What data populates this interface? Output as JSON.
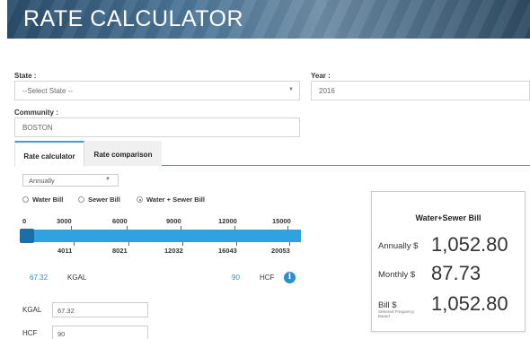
{
  "header": {
    "title": "RATE CALCULATOR"
  },
  "form": {
    "state_label": "State :",
    "state_value": "--Select State --",
    "year_label": "Year :",
    "year_value": "2016",
    "community_label": "Community :",
    "community_value": "BOSTON"
  },
  "tabs": [
    {
      "label": "Rate calculator",
      "active": true
    },
    {
      "label": "Rate comparison",
      "active": false
    }
  ],
  "frequency": {
    "selected": "Annually"
  },
  "bill_type": {
    "options": [
      "Water Bill",
      "Sewer Bill",
      "Water + Sewer Bill"
    ],
    "selected": "Water + Sewer Bill"
  },
  "slider": {
    "kgal_ticks": [
      "0",
      "3000",
      "6000",
      "9000",
      "12000",
      "15000"
    ],
    "hcf_ticks": [
      "4011",
      "8021",
      "12032",
      "16043",
      "20053"
    ],
    "value_fraction": 0.0
  },
  "usage": {
    "kgal_value": "67.32",
    "kgal_unit": "KGAL",
    "hcf_value": "90",
    "hcf_unit": "HCF",
    "info_icon": "info-icon"
  },
  "inputs": {
    "kgal_label": "KGAL",
    "kgal_value": "67.32",
    "hcf_label": "HCF",
    "hcf_value": "90"
  },
  "bill": {
    "title": "Water+Sewer Bill",
    "annually_label": "Annually $",
    "annually_value": "1,052.80",
    "monthly_label": "Monthly $",
    "monthly_value": "87.73",
    "bill_label": "Bill $",
    "bill_note": "Selected Frequency Based",
    "bill_value": "1,052.80"
  },
  "colors": {
    "accent": "#2fa3df",
    "handle": "#1d6ea8",
    "banner": "#3f6584"
  }
}
